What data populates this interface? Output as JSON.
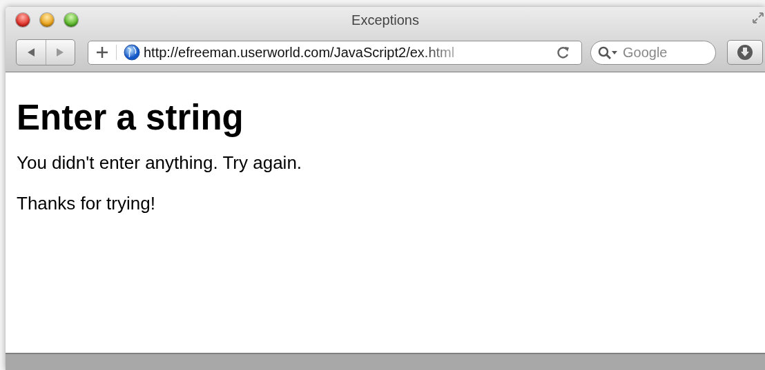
{
  "window": {
    "title": "Exceptions"
  },
  "toolbar": {
    "url": "http://efreeman.userworld.com/JavaScript2/ex.html",
    "search": {
      "placeholder": "Google"
    }
  },
  "page": {
    "heading": "Enter a string",
    "paragraphs": [
      "You didn't enter anything. Try again.",
      "Thanks for trying!"
    ]
  }
}
